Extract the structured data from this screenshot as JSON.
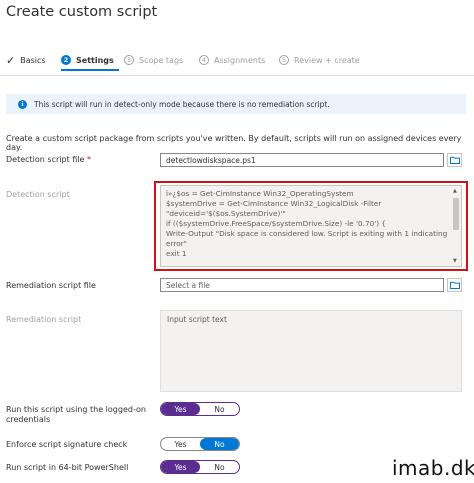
{
  "title": "Create custom script",
  "steps": [
    {
      "label": "Basics",
      "state": "done",
      "marker": "✓"
    },
    {
      "label": "Settings",
      "state": "active",
      "marker": "2"
    },
    {
      "label": "Scope tags",
      "state": "pending",
      "marker": "3"
    },
    {
      "label": "Assignments",
      "state": "pending",
      "marker": "4"
    },
    {
      "label": "Review + create",
      "state": "pending",
      "marker": "5"
    }
  ],
  "info_banner": {
    "icon": "i",
    "text": "This script will run in detect-only mode because there is no remediation script."
  },
  "description": "Create a custom script package from scripts you've written. By default, scripts will run on assigned devices every day.",
  "detection_script_file": {
    "label": "Detection script file",
    "required_mark": "*",
    "value": "detectlowdiskspace.ps1",
    "icon": "folder-icon"
  },
  "detection_script": {
    "label": "Detection script",
    "lines": [
      "ï»¿$os = Get-CimInstance Win32_OperatingSystem",
      "$systemDrive = Get-CimInstance Win32_LogicalDisk -Filter",
      "\"deviceid='$($os.SystemDrive)'\"",
      "if (($systemDrive.FreeSpace/$systemDrive.Size) -le '0.70') {",
      "    Write-Output \"Disk space is considered low. Script is exiting with 1 indicating",
      "error\"",
      "    exit 1"
    ]
  },
  "remediation_script_file": {
    "label": "Remediation script file",
    "placeholder": "Select a file",
    "icon": "folder-icon"
  },
  "remediation_script": {
    "label": "Remediation script",
    "placeholder": "Input script text"
  },
  "settings": [
    {
      "label_line1": "Run this script using the logged-on",
      "label_line2": "credentials",
      "yes": "Yes",
      "no": "No",
      "selected": "Yes"
    },
    {
      "label_line1": "Enforce script signature check",
      "label_line2": "",
      "yes": "Yes",
      "no": "No",
      "selected": "No"
    },
    {
      "label_line1": "Run script in 64-bit PowerShell",
      "label_line2": "",
      "yes": "Yes",
      "no": "No",
      "selected": "Yes"
    }
  ],
  "watermark": "imab.dk",
  "colors": {
    "accent": "#0078d4",
    "toggle_purple": "#5c2d91",
    "highlight_red": "#d0121b",
    "info_bg": "#eaf3fc"
  }
}
